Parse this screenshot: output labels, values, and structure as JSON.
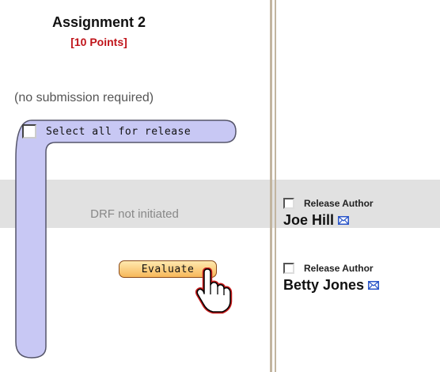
{
  "assignment": {
    "title": "Assignment 2",
    "points": "[10 Points]",
    "no_submission": "(no submission required)",
    "select_all_label": "Select all for release",
    "drf_status": "DRF not initiated",
    "evaluate_label": "Evaluate"
  },
  "students": [
    {
      "name": "Joe Hill",
      "release_label": "Release Author",
      "icon": "mail-icon"
    },
    {
      "name": "Betty Jones",
      "release_label": "Release Author",
      "icon": "mail-icon"
    }
  ],
  "colors": {
    "points": "#c0141a",
    "select_panel": "#c8c8f4",
    "evaluate_button": "#f7b85a",
    "row_highlight": "#e1e1e1",
    "divider": "#c2b5a0",
    "mail_icon": "#2a55c8"
  }
}
